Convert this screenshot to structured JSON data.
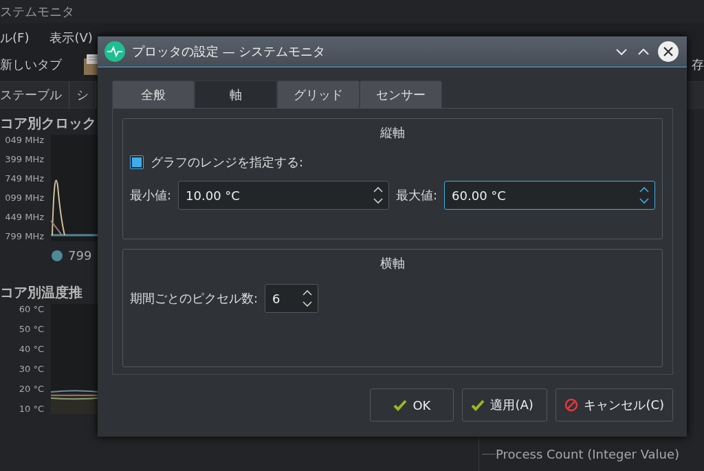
{
  "app": {
    "title": "ステムモニタ",
    "menu": [
      "ル(F)",
      "表示(V)"
    ],
    "toolbar": {
      "new_tab": "新しいタブ",
      "save": "存"
    },
    "tabs": [
      "ステーブル",
      "シ"
    ]
  },
  "panels": [
    {
      "kind": "clock",
      "title": "コア別クロック",
      "ticks": [
        "049 MHz",
        "399 MHz",
        "749 MHz",
        "099 MHz",
        "449 MHz",
        "799 MHz"
      ],
      "legend": [
        {
          "label": "799",
          "color": "#4e8a99"
        }
      ]
    },
    {
      "kind": "temp",
      "title": "コア別温度推",
      "ticks": [
        "60 °C",
        "50 °C",
        "40 °C",
        "30 °C",
        "20 °C",
        "10 °C"
      ]
    }
  ],
  "process_tree": {
    "label": "Process Count (Integer Value)"
  },
  "dialog": {
    "title": "プロッタの設定 — システムモニタ",
    "tabs": [
      {
        "label": "全般",
        "selected": false
      },
      {
        "label": "軸",
        "selected": true
      },
      {
        "label": "グリッド",
        "selected": false
      },
      {
        "label": "センサー",
        "selected": false
      }
    ],
    "vertical": {
      "title": "縦軸",
      "range_checkbox": {
        "label": "グラフのレンジを指定する:",
        "checked": true
      },
      "min": {
        "label": "最小値:",
        "value": "10.00 °C",
        "focused": false
      },
      "max": {
        "label": "最大値:",
        "value": "60.00 °C",
        "focused": true
      }
    },
    "horizontal": {
      "title": "横軸",
      "pixels": {
        "label": "期間ごとのピクセル数:",
        "value": "6",
        "focused": false
      }
    },
    "buttons": [
      {
        "kind": "ok",
        "label": "OK"
      },
      {
        "kind": "apply",
        "label": "適用(A)"
      },
      {
        "kind": "cancel",
        "label": "キャンセル(C)"
      }
    ]
  }
}
